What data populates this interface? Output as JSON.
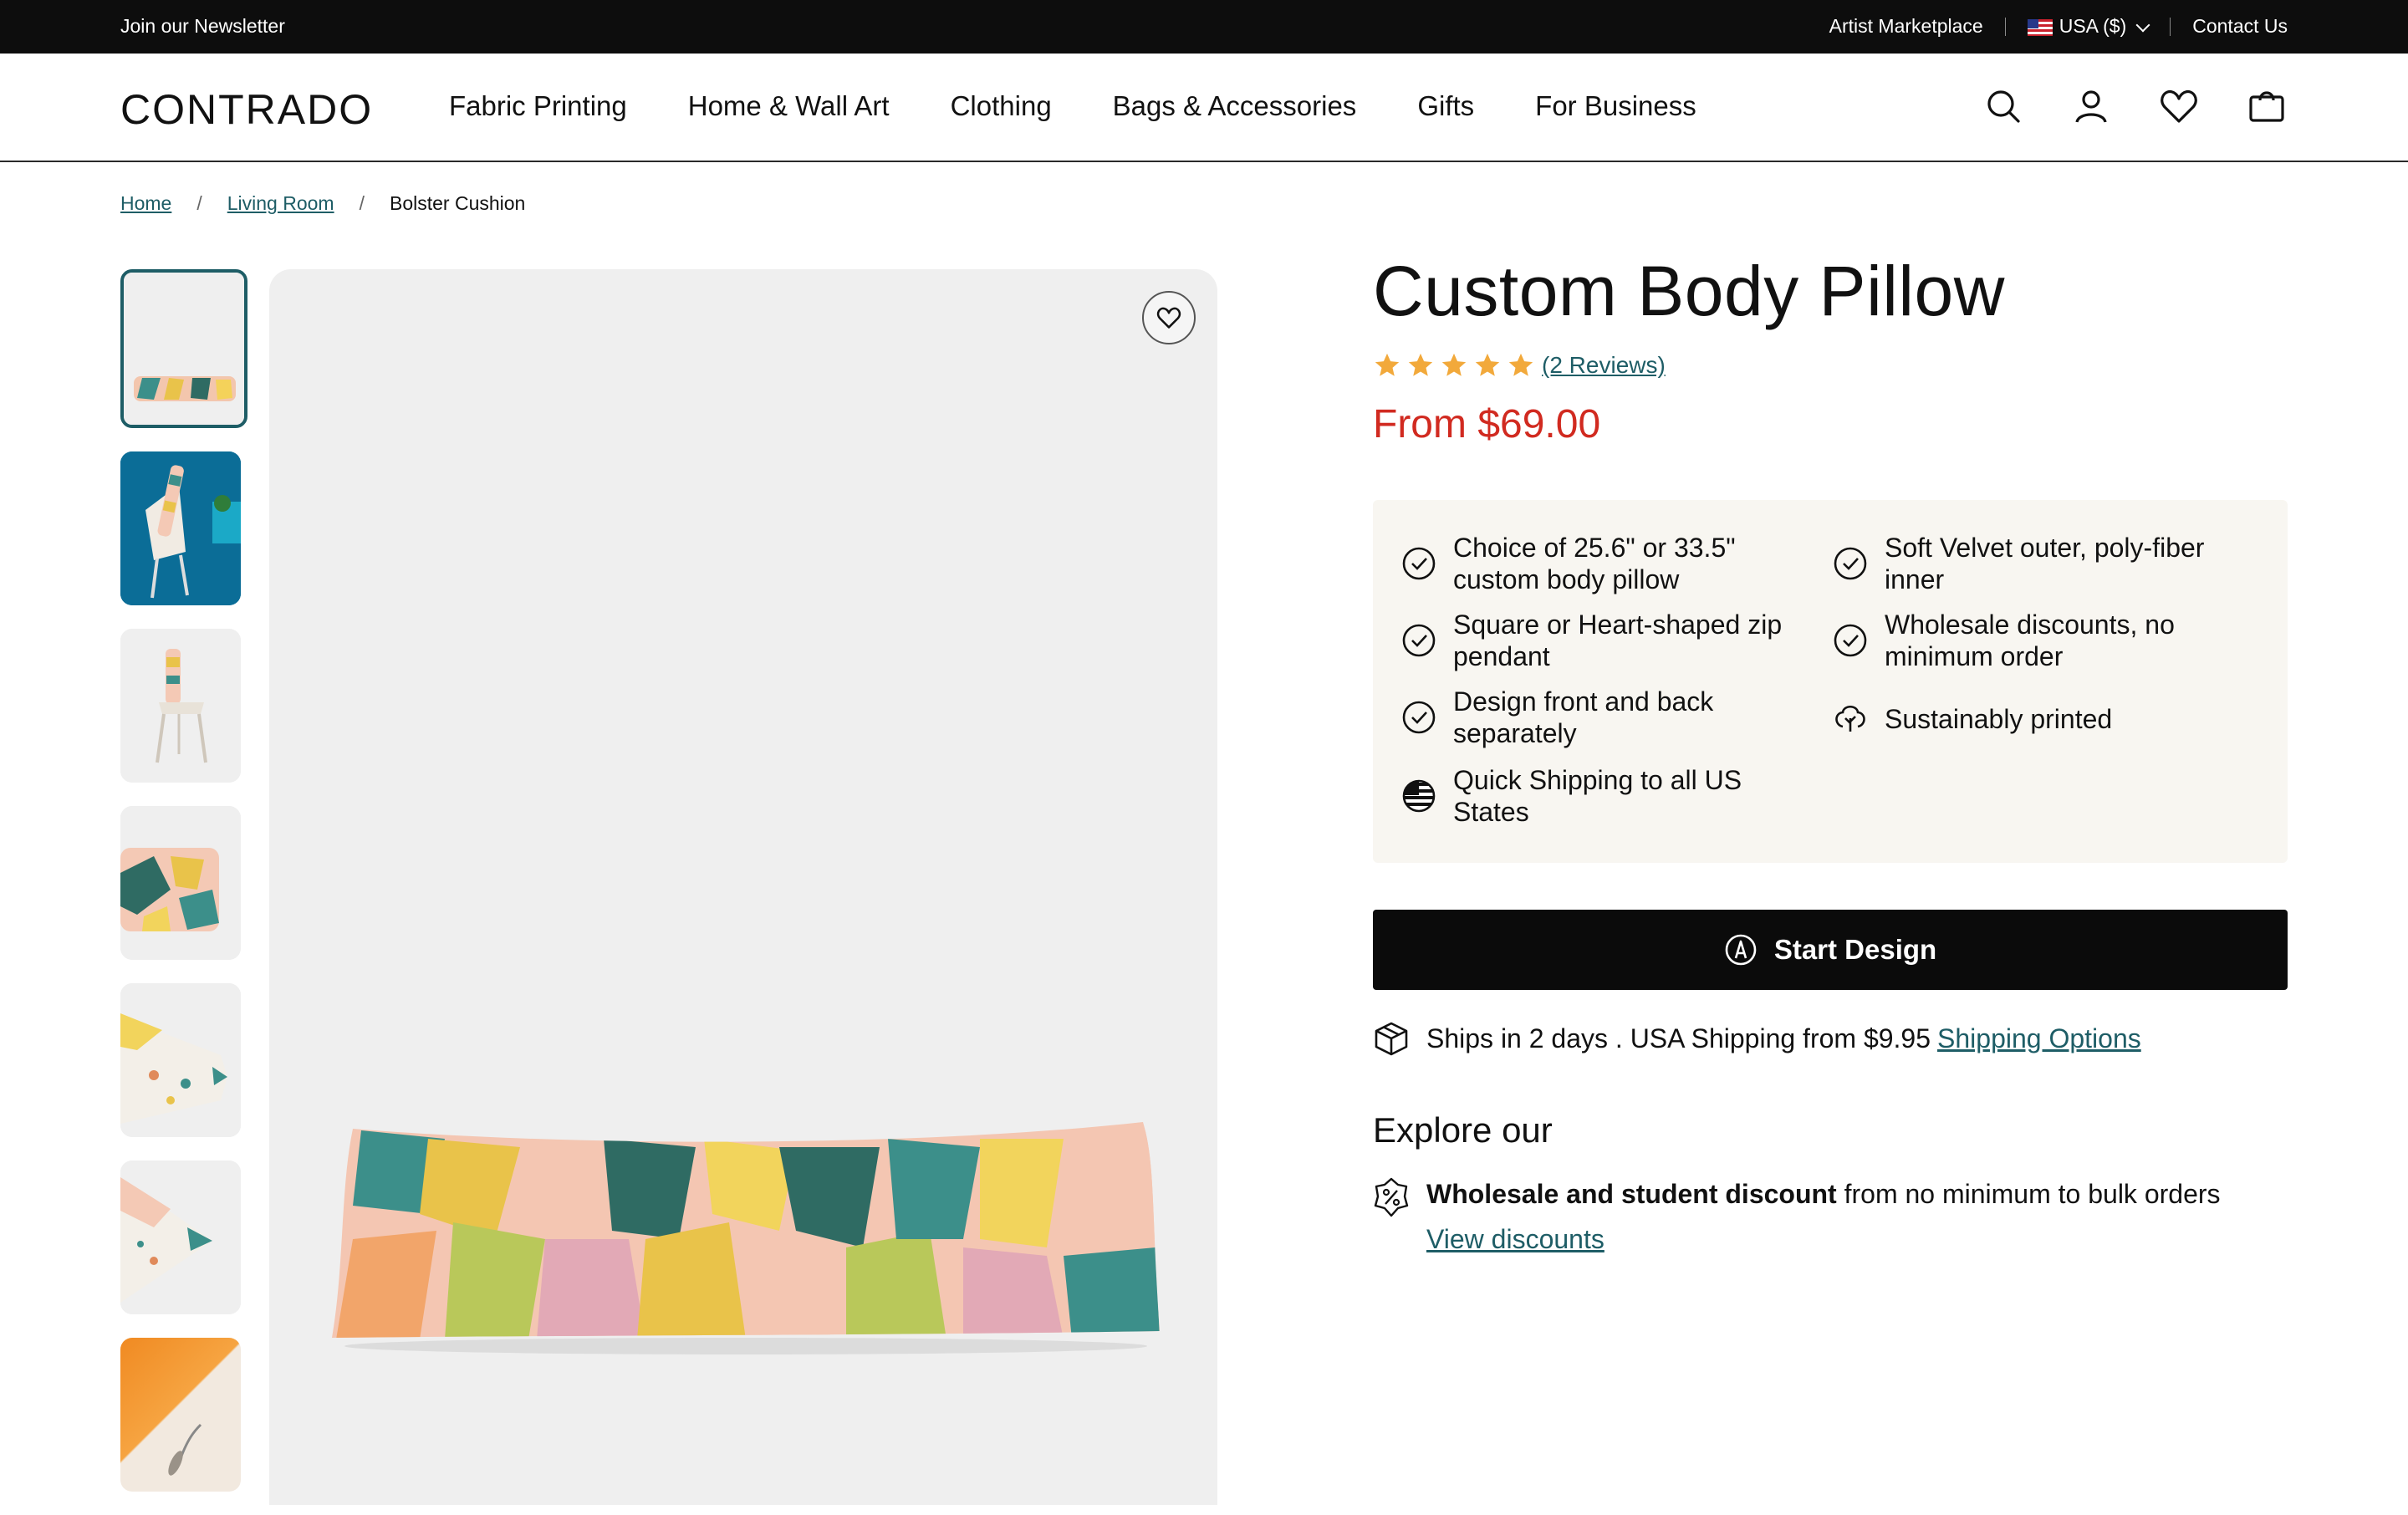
{
  "topbar": {
    "newsletter": "Join our Newsletter",
    "artist_marketplace": "Artist Marketplace",
    "currency": "USA ($)",
    "contact": "Contact Us"
  },
  "header": {
    "logo": "CONTRADO",
    "menu": [
      "Fabric Printing",
      "Home & Wall Art",
      "Clothing",
      "Bags & Accessories",
      "Gifts",
      "For Business"
    ],
    "icons": [
      "search-icon",
      "account-icon",
      "heart-icon",
      "bag-icon"
    ]
  },
  "breadcrumb": {
    "items": [
      "Home",
      "Living Room",
      "Bolster Cushion"
    ]
  },
  "gallery": {
    "thumbnail_count": 7,
    "active_index": 0
  },
  "product": {
    "title": "Custom Body Pillow",
    "rating": 5,
    "reviews": "(2 Reviews)",
    "price": "From $69.00",
    "features": [
      {
        "text": "Choice of 25.6\" or 33.5\" custom body pillow",
        "icon": "check-circle-icon"
      },
      {
        "text": "Soft Velvet outer, poly-fiber inner",
        "icon": "check-circle-icon"
      },
      {
        "text": "Square or Heart-shaped zip pendant",
        "icon": "check-circle-icon"
      },
      {
        "text": "Wholesale discounts, no minimum order",
        "icon": "check-circle-icon"
      },
      {
        "text": "Design front and back separately",
        "icon": "check-circle-icon"
      },
      {
        "text": "Sustainably printed",
        "icon": "tree-icon"
      },
      {
        "text": "Quick Shipping to all US States",
        "icon": "us-flag-icon"
      }
    ],
    "cta_label": "Start Design",
    "shipping_text": "Ships in 2 days . USA Shipping from $9.95",
    "shipping_link": "Shipping Options"
  },
  "explore": {
    "heading": "Explore our",
    "bold": "Wholesale and student discount",
    "rest": " from no minimum to bulk orders",
    "link": "View discounts"
  },
  "colors": {
    "accent_teal": "#1e5d66",
    "price_red": "#d12a20",
    "star_orange": "#f2a93b",
    "topbar_black": "#0d0d0d",
    "feature_bg": "#f8f6f1"
  }
}
